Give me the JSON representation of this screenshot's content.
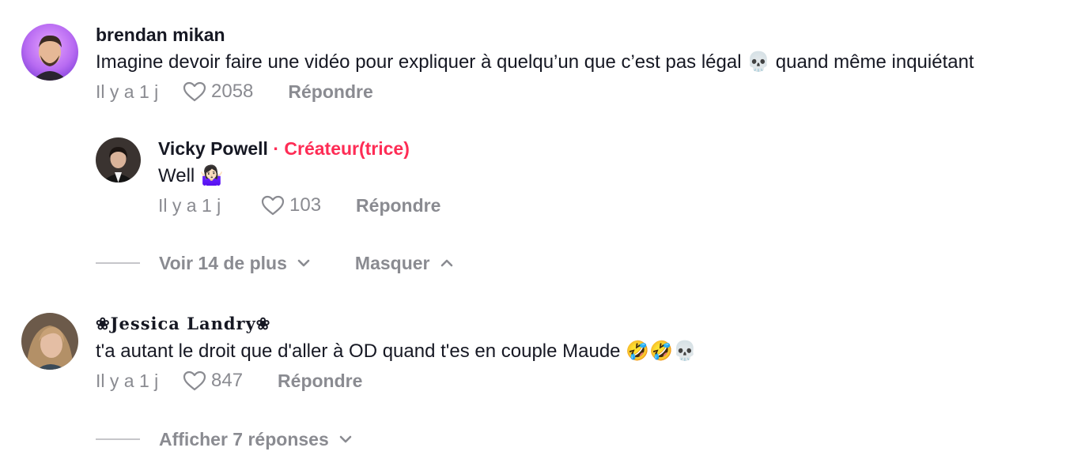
{
  "comments": [
    {
      "username": "brendan mikan",
      "text": "Imagine devoir faire une vidéo pour expliquer à quelqu’un que c’est pas légal 💀 quand même inquiétant",
      "time": "Il y a 1 j",
      "likes": "2058",
      "reply_label": "Répondre",
      "icon": "heart-outline-icon"
    },
    {
      "username": "Vicky Powell",
      "creator_separator": "·",
      "creator_label": "Créateur(trice)",
      "text": "Well 🤷🏻‍♀️",
      "time": "Il y a 1 j",
      "likes": "103",
      "reply_label": "Répondre"
    },
    {
      "username": "❀𝐉𝐞𝐬𝐬𝐢𝐜𝐚 𝐋𝐚𝐧𝐝𝐫𝐲❀",
      "text": "t'a autant le droit que d'aller à OD quand t'es en couple Maude 🤣🤣💀",
      "time": "Il y a 1 j",
      "likes": "847",
      "reply_label": "Répondre"
    }
  ],
  "thread_controls": {
    "see_more_label": "Voir 14 de plus",
    "hide_label": "Masquer",
    "show_replies_label": "Afficher 7 réponses"
  },
  "colors": {
    "creator_accent": "#fe2c55",
    "muted": "#8a8b91",
    "text": "#161823"
  }
}
